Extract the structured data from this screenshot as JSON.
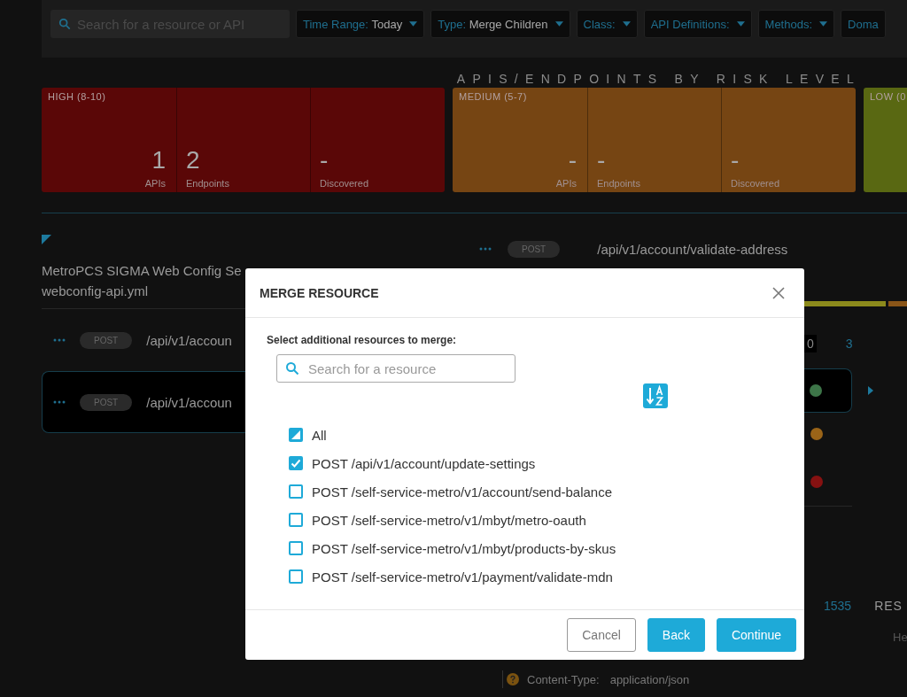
{
  "toolbar": {
    "search": {
      "placeholder": "Search for a resource or API"
    },
    "filters": [
      {
        "label": "Time Range:",
        "value": "Today"
      },
      {
        "label": "Type:",
        "value": "Merge Children"
      },
      {
        "label": "Class:"
      },
      {
        "label": "API Definitions:"
      },
      {
        "label": "Methods:"
      }
    ],
    "cut_filter": {
      "label": "Doma"
    }
  },
  "risk_section": {
    "title": "APIS/ENDPOINTS BY RISK LEVEL",
    "levels": [
      {
        "label": "HIGH (8-10)",
        "color": "#5a0707",
        "stats": [
          {
            "value": "1",
            "label": "APIs"
          },
          {
            "value": "2",
            "label": "Endpoints"
          },
          {
            "value": "-",
            "label": "Discovered"
          }
        ]
      },
      {
        "label": "MEDIUM (5-7)",
        "color": "#764513",
        "stats": [
          {
            "value": "-",
            "label": "APIs"
          },
          {
            "value": "-",
            "label": "Endpoints"
          },
          {
            "value": "-",
            "label": "Discovered"
          }
        ]
      },
      {
        "label": "LOW (0",
        "color": "#596812"
      }
    ]
  },
  "definition": {
    "title": "MetroPCS SIGMA Web Config Se",
    "file": "webconfig-api.yml",
    "endpoints": [
      {
        "method": "POST",
        "path": "/api/v1/accoun",
        "selected": false
      },
      {
        "method": "POST",
        "path": "/api/v1/accoun",
        "selected": true
      }
    ]
  },
  "detail": {
    "method": "POST",
    "path": "/api/v1/account/validate-address",
    "risk_bar": [
      {
        "color": "#8c8a1c"
      },
      {
        "color": "#8a5518"
      }
    ],
    "counts": [
      {
        "label": "0",
        "selected": true
      },
      {
        "label": "3",
        "selected": false
      }
    ],
    "status_rows": [
      {
        "color": "#3d7548",
        "selected": true
      },
      {
        "color": "#9a6418",
        "selected": false
      },
      {
        "color": "#861111",
        "selected": false
      }
    ],
    "response_code": "1535",
    "response_label": "RES",
    "header_label": "He",
    "header": {
      "name": "Content-Type:",
      "value": "application/json"
    }
  },
  "dialog": {
    "title": "MERGE RESOURCE",
    "prompt": "Select additional resources to merge:",
    "search": {
      "placeholder": "Search for a resource"
    },
    "all": {
      "label": "All",
      "indeterminate": true
    },
    "items": [
      {
        "label": "POST /api/v1/account/update-settings",
        "checked": true
      },
      {
        "label": "POST /self-service-metro/v1/account/send-balance",
        "checked": false
      },
      {
        "label": "POST /self-service-metro/v1/mbyt/metro-oauth",
        "checked": false
      },
      {
        "label": "POST /self-service-metro/v1/mbyt/products-by-skus",
        "checked": false
      },
      {
        "label": "POST /self-service-metro/v1/payment/validate-mdn",
        "checked": false
      }
    ],
    "buttons": [
      {
        "label": "Cancel",
        "kind": "secondary"
      },
      {
        "label": "Back",
        "kind": "primary"
      },
      {
        "label": "Continue",
        "kind": "primary"
      }
    ]
  }
}
